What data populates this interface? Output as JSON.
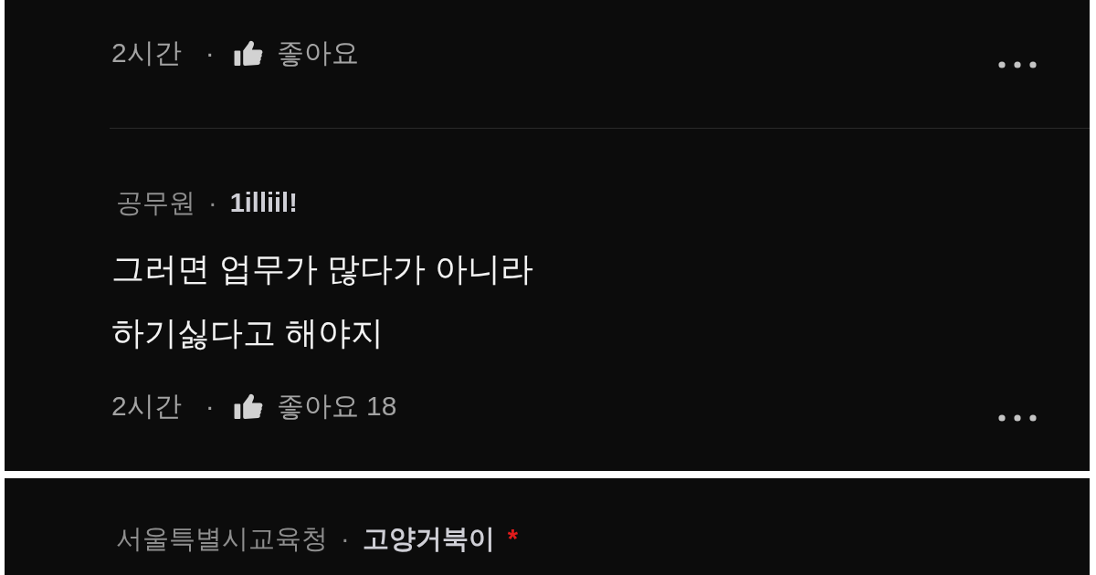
{
  "panels": [
    {
      "comments": [
        {
          "footer": {
            "time": "2시간",
            "separator": "·",
            "like_label": "좋아요"
          }
        },
        {
          "author": {
            "affiliation": "공무원",
            "separator": "·",
            "nickname": "1illiil!"
          },
          "body": "그러면 업무가 많다가 아니라\n하기싫다고 해야지",
          "footer": {
            "time": "2시간",
            "separator": "·",
            "like_label": "좋아요",
            "like_count": "18"
          }
        }
      ]
    },
    {
      "comments": [
        {
          "author": {
            "affiliation": "서울특별시교육청",
            "separator": "·",
            "nickname": "고양거북이",
            "marker": "*"
          }
        }
      ]
    }
  ]
}
